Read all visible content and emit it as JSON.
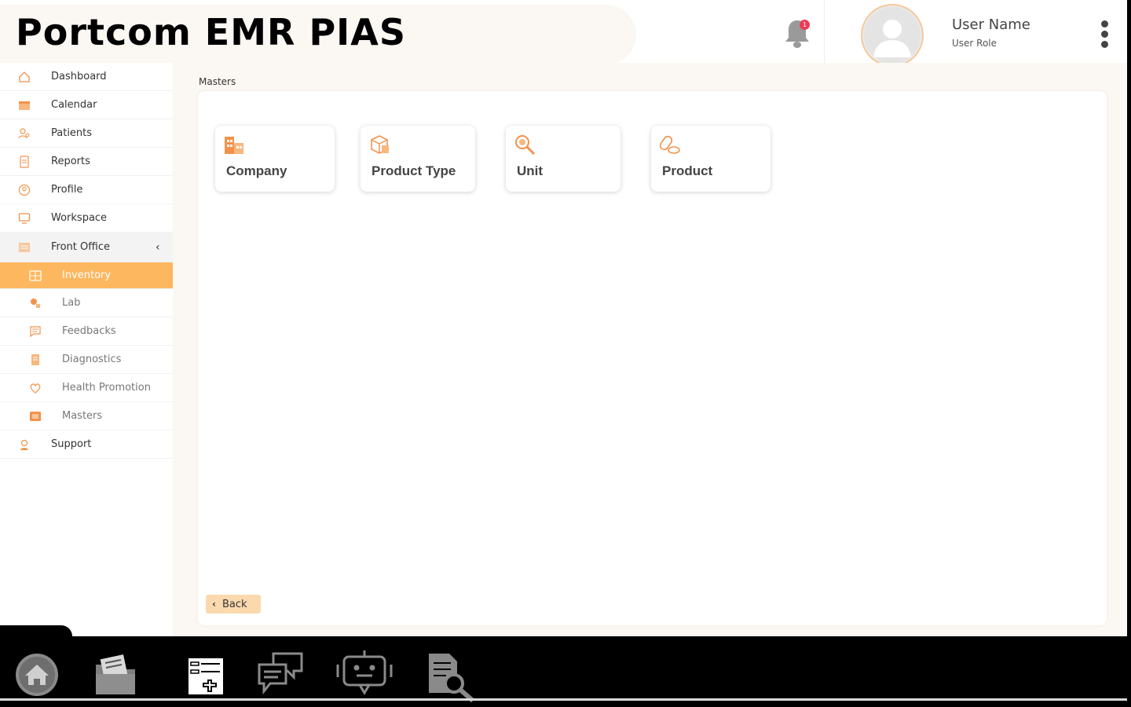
{
  "header": {
    "app_title": "Portcom EMR PIAS",
    "notification_count": "1",
    "user_name": "User Name",
    "user_role": "User Role"
  },
  "sidebar": {
    "items": [
      {
        "label": "Dashboard",
        "icon": "home-icon"
      },
      {
        "label": "Calendar",
        "icon": "calendar-icon"
      },
      {
        "label": "Patients",
        "icon": "patients-icon"
      },
      {
        "label": "Reports",
        "icon": "reports-icon"
      },
      {
        "label": "Profile",
        "icon": "profile-icon"
      },
      {
        "label": "Workspace",
        "icon": "workspace-icon"
      },
      {
        "label": "Front Office",
        "icon": "front-office-icon"
      },
      {
        "label": "Inventory",
        "icon": "inventory-icon"
      },
      {
        "label": "Lab",
        "icon": "lab-icon"
      },
      {
        "label": "Feedbacks",
        "icon": "feedback-icon"
      },
      {
        "label": "Diagnostics",
        "icon": "diagnostics-icon"
      },
      {
        "label": "Health Promotion",
        "icon": "health-promotion-icon"
      },
      {
        "label": "Masters",
        "icon": "masters-icon"
      },
      {
        "label": "Support",
        "icon": "support-icon"
      }
    ]
  },
  "main": {
    "breadcrumb": "Masters",
    "tiles": [
      {
        "label": "Company",
        "icon": "company-building-icon"
      },
      {
        "label": "Product Type",
        "icon": "product-type-box-icon"
      },
      {
        "label": "Unit",
        "icon": "unit-search-icon"
      },
      {
        "label": "Product",
        "icon": "product-pills-icon"
      }
    ],
    "back_label": "Back"
  },
  "taskbar": {
    "icons": [
      "home-icon",
      "folder-documents-icon",
      "medical-record-icon",
      "chat-icon",
      "robot-icon",
      "document-search-icon"
    ]
  },
  "colors": {
    "accent": "#fdb75f",
    "icon_orange": "#f2924a",
    "badge": "#ef3b55",
    "main_bg": "#fbf7f2"
  }
}
